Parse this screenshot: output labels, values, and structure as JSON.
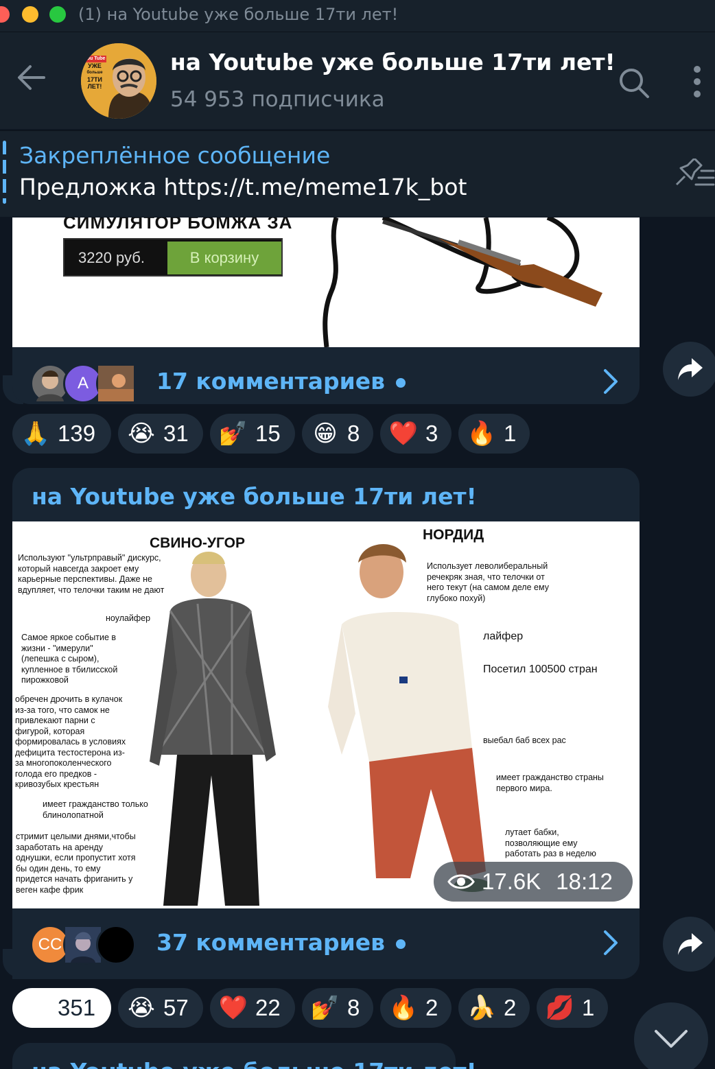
{
  "window": {
    "title": "(1) на Youtube уже больше 17ти лет!"
  },
  "channel": {
    "name": "на Youtube уже больше 17ти лет!",
    "subscribers": "54 953 подписчика",
    "avatar_text": [
      "You Tube",
      "УЖЕ",
      "больше",
      "17ТИ",
      "ЛЕТ!"
    ]
  },
  "pinned": {
    "label": "Закреплённое сообщение",
    "text": "Предложка https://t.me/meme17k_bot"
  },
  "post1": {
    "image": {
      "game_title": "СИМУЛЯТОР БОМЖА ЗА",
      "price": "3220 руб.",
      "cart_button": "В корзину"
    },
    "comments": {
      "label": "17 комментариев",
      "avatar_letter": "A"
    },
    "reactions": [
      {
        "icon": "folded-hands",
        "emoji": "🙏",
        "count": "139"
      },
      {
        "icon": "loudly-crying-face",
        "emoji": "😭",
        "count": "31"
      },
      {
        "icon": "nail-polish",
        "emoji": "💅",
        "count": "15"
      },
      {
        "icon": "grinning-face",
        "emoji": "😁",
        "count": "8"
      },
      {
        "icon": "red-heart",
        "emoji": "❤️",
        "count": "3"
      },
      {
        "icon": "fire",
        "emoji": "🔥",
        "count": "1"
      }
    ]
  },
  "post2": {
    "author": "на Youtube уже больше 17ти лет!",
    "image": {
      "left_title": "СВИНО-УГОР",
      "right_title": "НОРДИД",
      "left_notes": [
        "Используют \"ультрправый\" дискурс,\nкоторый навсегда закроет ему\nкарьерные перспективы. Даже не\nвдупляет, что телочки таким не дают",
        "ноулайфер",
        "Самое яркое событие в\nжизни - \"имерули\"\n(лепешка с сыром),\nкупленное в тбилисской\nпирожковой",
        "обречен дрочить в кулачок\nиз-за того, что самок не\nпривлекают парни с\nфигурой, которая\nформировалась в условиях\nдефицита тестостерона из-\nза многопоколенческого\nголода его предков -\nкривозубых крестьян",
        "имеет гражданство только\nблинолопатной",
        "стримит целыми днями,чтобы\nзаработать на аренду\nоднушки, если пропустит хотя\nбы один день, то ему\nпридется начать фриганить у\nвеген кафе фрик"
      ],
      "right_notes": [
        "Использует леволиберальный\nречекряк зная, что телочки от\nнего текут (на самом деле ему\nглубоко похуй)",
        "лайфер",
        "Посетил 100500 стран",
        "выебал баб всех рас",
        "имеет гражданство страны\nпервого мира.",
        "лутает бабки,\nпозволяющие ему\nработать раз в неделю"
      ]
    },
    "views": "17.6K",
    "time": "18:12",
    "comments": {
      "label": "37 комментариев",
      "avatar_letters": "CC"
    },
    "reactions": [
      {
        "icon": "grinning-face",
        "emoji": "😁",
        "count": "351",
        "active": true
      },
      {
        "icon": "loudly-crying-face",
        "emoji": "😭",
        "count": "57"
      },
      {
        "icon": "red-heart",
        "emoji": "❤️",
        "count": "22"
      },
      {
        "icon": "nail-polish",
        "emoji": "💅",
        "count": "8"
      },
      {
        "icon": "fire",
        "emoji": "🔥",
        "count": "2"
      },
      {
        "icon": "banana",
        "emoji": "🍌",
        "count": "2"
      },
      {
        "icon": "kiss-mark",
        "emoji": "💋",
        "count": "1"
      }
    ]
  },
  "post3": {
    "author": "на Youtube уже больше 17ти лет!"
  },
  "colors": {
    "background": "#0e1621",
    "header": "#17212b",
    "bubble": "#182533",
    "accent": "#5eb5f7",
    "muted": "#7f8b97"
  }
}
